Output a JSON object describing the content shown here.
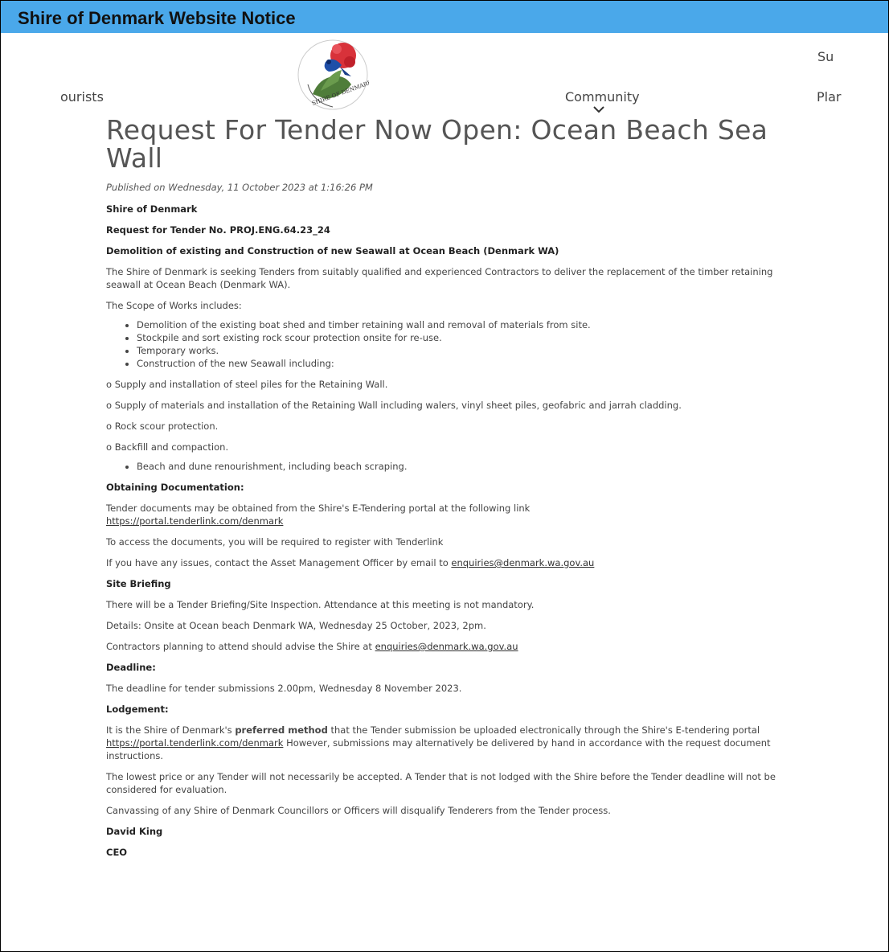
{
  "notice": {
    "title": "Shire of Denmark Website Notice"
  },
  "nav": {
    "left_partial": "ourists",
    "community": "Community",
    "right_partial": "Plar",
    "right_top_partial": "Su"
  },
  "logo": {
    "text": "SHIRE OF DENMARK"
  },
  "article": {
    "title": "Request For Tender Now Open: Ocean Beach Sea Wall",
    "published": "Published on Wednesday, 11 October 2023 at 1:16:26 PM",
    "org": "Shire of Denmark",
    "rft_no": "Request for Tender No. PROJ.ENG.64.23_24",
    "subject": "Demolition of existing and Construction of new Seawall at Ocean Beach (Denmark WA)",
    "intro": "The Shire of Denmark is seeking Tenders from suitably qualified and experienced Contractors to deliver the replacement of the timber retaining seawall at Ocean Beach (Denmark WA).",
    "scope_heading": "The Scope of Works includes:",
    "scope_items": [
      "Demolition of the existing boat shed and timber retaining wall and removal of materials from site.",
      "Stockpile and sort existing rock scour protection onsite for re-use.",
      "Temporary works.",
      "Construction of the new Seawall including:"
    ],
    "sub_items": [
      "o Supply and installation of steel piles for the Retaining Wall.",
      "o Supply of materials and installation of the Retaining Wall including walers, vinyl sheet piles, geofabric and jarrah cladding.",
      "o Rock scour protection.",
      "o Backfill and compaction."
    ],
    "scope_last": "Beach and dune renourishment, including beach scraping.",
    "doc_heading": "Obtaining Documentation:",
    "doc_text": "Tender documents may be obtained from the Shire's E-Tendering portal at the following link",
    "portal_link": "https://portal.tenderlink.com/denmark",
    "register_text": "To access the documents, you will be required to register with Tenderlink",
    "issues_text": "If you have any issues, contact the Asset Management Officer by email to",
    "email": "enquiries@denmark.wa.gov.au",
    "briefing_heading": "Site Briefing",
    "briefing_text": "There will be a Tender Briefing/Site Inspection. Attendance at this meeting is not mandatory.",
    "briefing_details": "Details: Onsite at Ocean beach Denmark WA, Wednesday 25 October, 2023, 2pm.",
    "attend_text": "Contractors planning to attend should advise the Shire at",
    "deadline_heading": "Deadline:",
    "deadline_text": "The deadline for tender submissions 2.00pm, Wednesday 8 November 2023.",
    "lodgement_heading": "Lodgement:",
    "lodge_pre": "It is the Shire of Denmark's",
    "lodge_bold": "preferred method",
    "lodge_mid": "that the Tender submission be uploaded electronically through the Shire's E-tendering portal",
    "lodge_post": "However, submissions may alternatively be delivered by hand in accordance with the request document instructions.",
    "lowest_text": "The lowest price or any Tender will not necessarily be accepted. A Tender that is not lodged with the Shire before the Tender deadline will not be considered for evaluation.",
    "canvass_text": "Canvassing of any Shire of Denmark Councillors or Officers will disqualify Tenderers from the Tender process.",
    "signatory": "David King",
    "signatory_role": "CEO"
  },
  "colors": {
    "notice_bar": "#4aa8ea",
    "title_text": "#555555"
  }
}
